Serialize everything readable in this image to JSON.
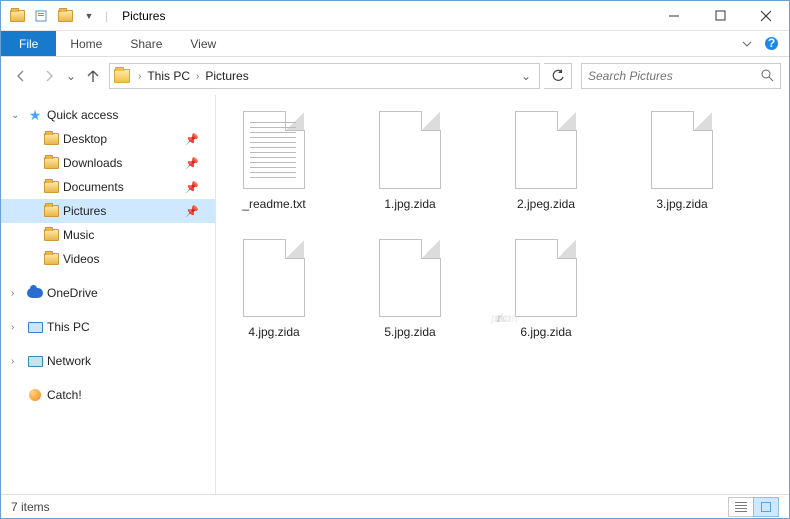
{
  "titlebar": {
    "title": "Pictures"
  },
  "ribbon": {
    "file": "File",
    "home": "Home",
    "share": "Share",
    "view": "View"
  },
  "breadcrumb": {
    "this_pc": "This PC",
    "folder": "Pictures"
  },
  "search": {
    "placeholder": "Search Pictures"
  },
  "sidebar": {
    "quick_access": "Quick access",
    "items": [
      {
        "label": "Desktop"
      },
      {
        "label": "Downloads"
      },
      {
        "label": "Documents"
      },
      {
        "label": "Pictures"
      },
      {
        "label": "Music"
      },
      {
        "label": "Videos"
      }
    ],
    "onedrive": "OneDrive",
    "this_pc": "This PC",
    "network": "Network",
    "catch": "Catch!"
  },
  "files": [
    {
      "name": "_readme.txt",
      "type": "txt"
    },
    {
      "name": "1.jpg.zida",
      "type": "blank"
    },
    {
      "name": "2.jpeg.zida",
      "type": "blank"
    },
    {
      "name": "3.jpg.zida",
      "type": "blank"
    },
    {
      "name": "4.jpg.zida",
      "type": "blank"
    },
    {
      "name": "5.jpg.zida",
      "type": "blank"
    },
    {
      "name": "6.jpg.zida",
      "type": "blank"
    }
  ],
  "status": {
    "count": "7 items"
  },
  "watermark": {
    "p": "p",
    "c": "c",
    "r": "r",
    "isk": "isk",
    "com": ".com"
  }
}
